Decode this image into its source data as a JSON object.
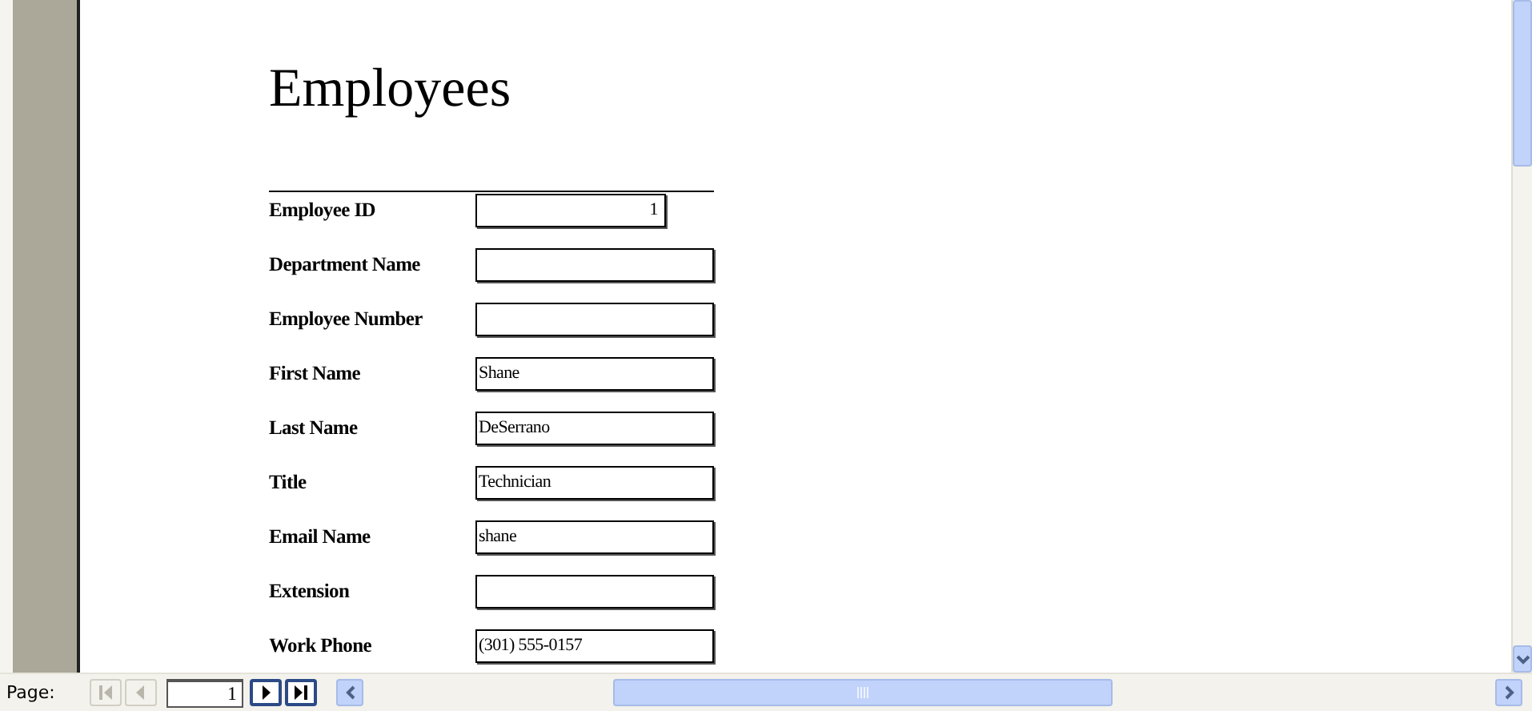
{
  "report": {
    "title": "Employees",
    "fields": [
      {
        "label": "Employee ID",
        "value": "1",
        "kind": "number"
      },
      {
        "label": "Department Name",
        "kind": "text"
      },
      {
        "label": "Employee Number",
        "kind": "text"
      },
      {
        "label": "First Name",
        "value": "Shane",
        "kind": "text"
      },
      {
        "label": "Last Name",
        "value": "DeSerrano",
        "kind": "text"
      },
      {
        "label": "Title",
        "value": "Technician",
        "kind": "text"
      },
      {
        "label": "Email Name",
        "value": "shane",
        "kind": "text"
      },
      {
        "label": "Extension",
        "kind": "text"
      },
      {
        "label": "Work Phone",
        "value": "(301) 555-0157",
        "kind": "text"
      }
    ]
  },
  "navigation": {
    "label": "Page:",
    "page": "1",
    "buttons": [
      {
        "kind": "first",
        "disabled": true
      },
      {
        "kind": "prev",
        "disabled": true
      },
      {
        "kind": "next",
        "disabled": false
      },
      {
        "kind": "last",
        "disabled": false
      }
    ]
  }
}
